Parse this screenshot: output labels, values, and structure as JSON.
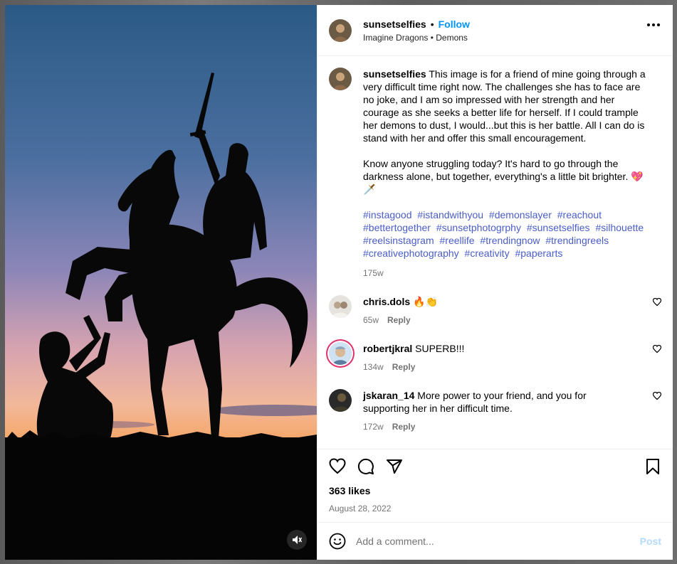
{
  "post": {
    "username": "sunsetselfies",
    "follow_label": "Follow",
    "audio": "Imagine Dragons • Demons",
    "caption_p1": "This image is for a friend of mine going through a very difficult time right now. The challenges she has to face are no joke, and I am so impressed with her strength and her courage as she seeks a better life for herself. If I could trample her demons to dust, I would...but this is her battle. All I can do is stand with her and offer this small encouragement.",
    "caption_p2": "Know anyone struggling today? It's hard to go through the darkness alone, but together, everything's a little bit brighter. 💖🗡️",
    "hashtags": [
      "#instagood",
      "#istandwithyou",
      "#demonslayer",
      "#reachout",
      "#bettertogether",
      "#sunsetphotogrphy",
      "#sunsetselfies",
      "#silhouette",
      "#reelsinstagram",
      "#reellife",
      "#trendingnow",
      "#trendingreels",
      "#creativephotography",
      "#creativity",
      "#paperarts"
    ],
    "caption_time": "175w",
    "likes": "363 likes",
    "date": "August 28, 2022",
    "comment_placeholder": "Add a comment...",
    "post_label": "Post"
  },
  "comments": [
    {
      "user": "chris.dols",
      "text": "🔥👏",
      "time": "65w",
      "reply": "Reply"
    },
    {
      "user": "robertjkral",
      "text": "SUPERB!!!",
      "time": "134w",
      "reply": "Reply"
    },
    {
      "user": "jskaran_14",
      "text": "More power to your friend, and you for supporting her in her difficult time.",
      "time": "172w",
      "reply": "Reply"
    }
  ],
  "icons": {
    "more": "more-options-icon",
    "like": "heart-icon",
    "comment": "comment-icon",
    "share": "share-icon",
    "save": "bookmark-icon",
    "emoji": "emoji-icon",
    "mute": "volume-muted-icon"
  },
  "colors": {
    "link": "#4a5dc7",
    "follow": "#0095f6",
    "post_disabled": "#b3dbff"
  }
}
